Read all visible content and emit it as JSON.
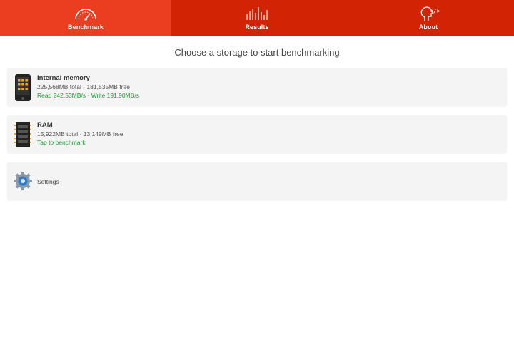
{
  "tabs": [
    {
      "label": "Benchmark",
      "icon": "speedometer-icon",
      "active": true
    },
    {
      "label": "Results",
      "icon": "bar-chart-icon",
      "active": false
    },
    {
      "label": "About",
      "icon": "head-code-icon",
      "active": false
    }
  ],
  "heading": "Choose a storage to start benchmarking",
  "storages": [
    {
      "title": "Internal memory",
      "details": "225,568MB total · 181,535MB free",
      "status": "Read 242.53MB/s · Write 191.90MB/s",
      "icon": "phone-storage-icon"
    },
    {
      "title": "RAM",
      "details": "15,922MB total · 13,149MB free",
      "status": "Tap to benchmark",
      "icon": "ram-chip-icon"
    }
  ],
  "settings": {
    "label": "Settings",
    "icon": "gear-icon"
  },
  "colors": {
    "tabbar": "#d32305",
    "tab_active": "#eb3d1f",
    "status_green": "#1e9a35"
  }
}
